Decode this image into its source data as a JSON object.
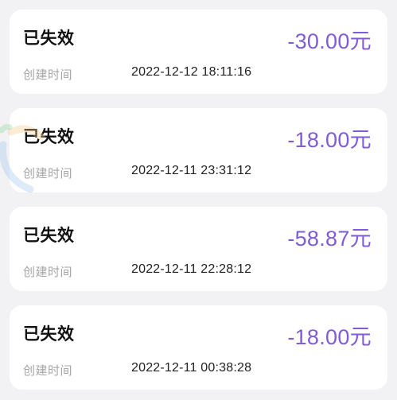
{
  "records": [
    {
      "status": "已失效",
      "amount": "-30.00元",
      "time_label": "创建时间",
      "time": "2022-12-12 18:11:16"
    },
    {
      "status": "已失效",
      "amount": "-18.00元",
      "time_label": "创建时间",
      "time": "2022-12-11 23:31:12"
    },
    {
      "status": "已失效",
      "amount": "-58.87元",
      "time_label": "创建时间",
      "time": "2022-12-11 22:28:12"
    },
    {
      "status": "已失效",
      "amount": "-18.00元",
      "time_label": "创建时间",
      "time": "2022-12-11 00:38:28"
    }
  ],
  "colors": {
    "amount": "#7f5bd8",
    "background": "#f2f2f4",
    "card": "#ffffff",
    "label": "#a6a6a6"
  }
}
